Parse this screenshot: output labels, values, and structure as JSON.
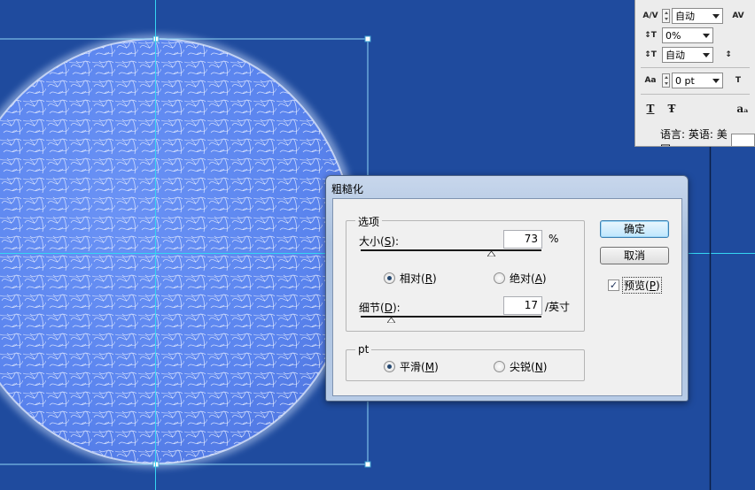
{
  "character_panel": {
    "rows": [
      {
        "icon": "kerning-icon",
        "icon_text": "A/V",
        "value": "自动",
        "second_icon_text": "AV"
      },
      {
        "icon": "baseline-scale-icon",
        "icon_text": "↕T",
        "value": "0%"
      },
      {
        "icon": "char-rotate-icon",
        "icon_text": "↕T",
        "value": "自动",
        "second_icon_text": "↕"
      },
      {
        "icon": "baseline-shift-icon",
        "icon_text": "Aa",
        "value": "0 pt",
        "second_icon_text": "T"
      }
    ],
    "style_buttons": [
      "T",
      "Ŧ",
      "aₐ"
    ],
    "language_label": "语言: 英语: 美国"
  },
  "dialog": {
    "title": "粗糙化",
    "options_group": {
      "label": "选项",
      "size_label": "大小",
      "size_accel": "S",
      "size_value": "73",
      "size_unit": "%",
      "mode_relative": "相对",
      "mode_relative_accel": "R",
      "mode_absolute": "绝对",
      "mode_absolute_accel": "A",
      "mode_selected": "relative",
      "detail_label": "细节",
      "detail_accel": "D",
      "detail_value": "17",
      "detail_unit": "/英寸"
    },
    "point_group": {
      "label": "pt",
      "smooth": "平滑",
      "smooth_accel": "M",
      "corner": "尖锐",
      "corner_accel": "N",
      "selected": "smooth"
    },
    "ok_label": "确定",
    "cancel_label": "取消",
    "preview_label": "预览",
    "preview_accel": "P",
    "preview_checked": true
  },
  "colors": {
    "background": "#1f4b9e",
    "guide": "#35d6f2",
    "sphere": "#5b86f0"
  }
}
